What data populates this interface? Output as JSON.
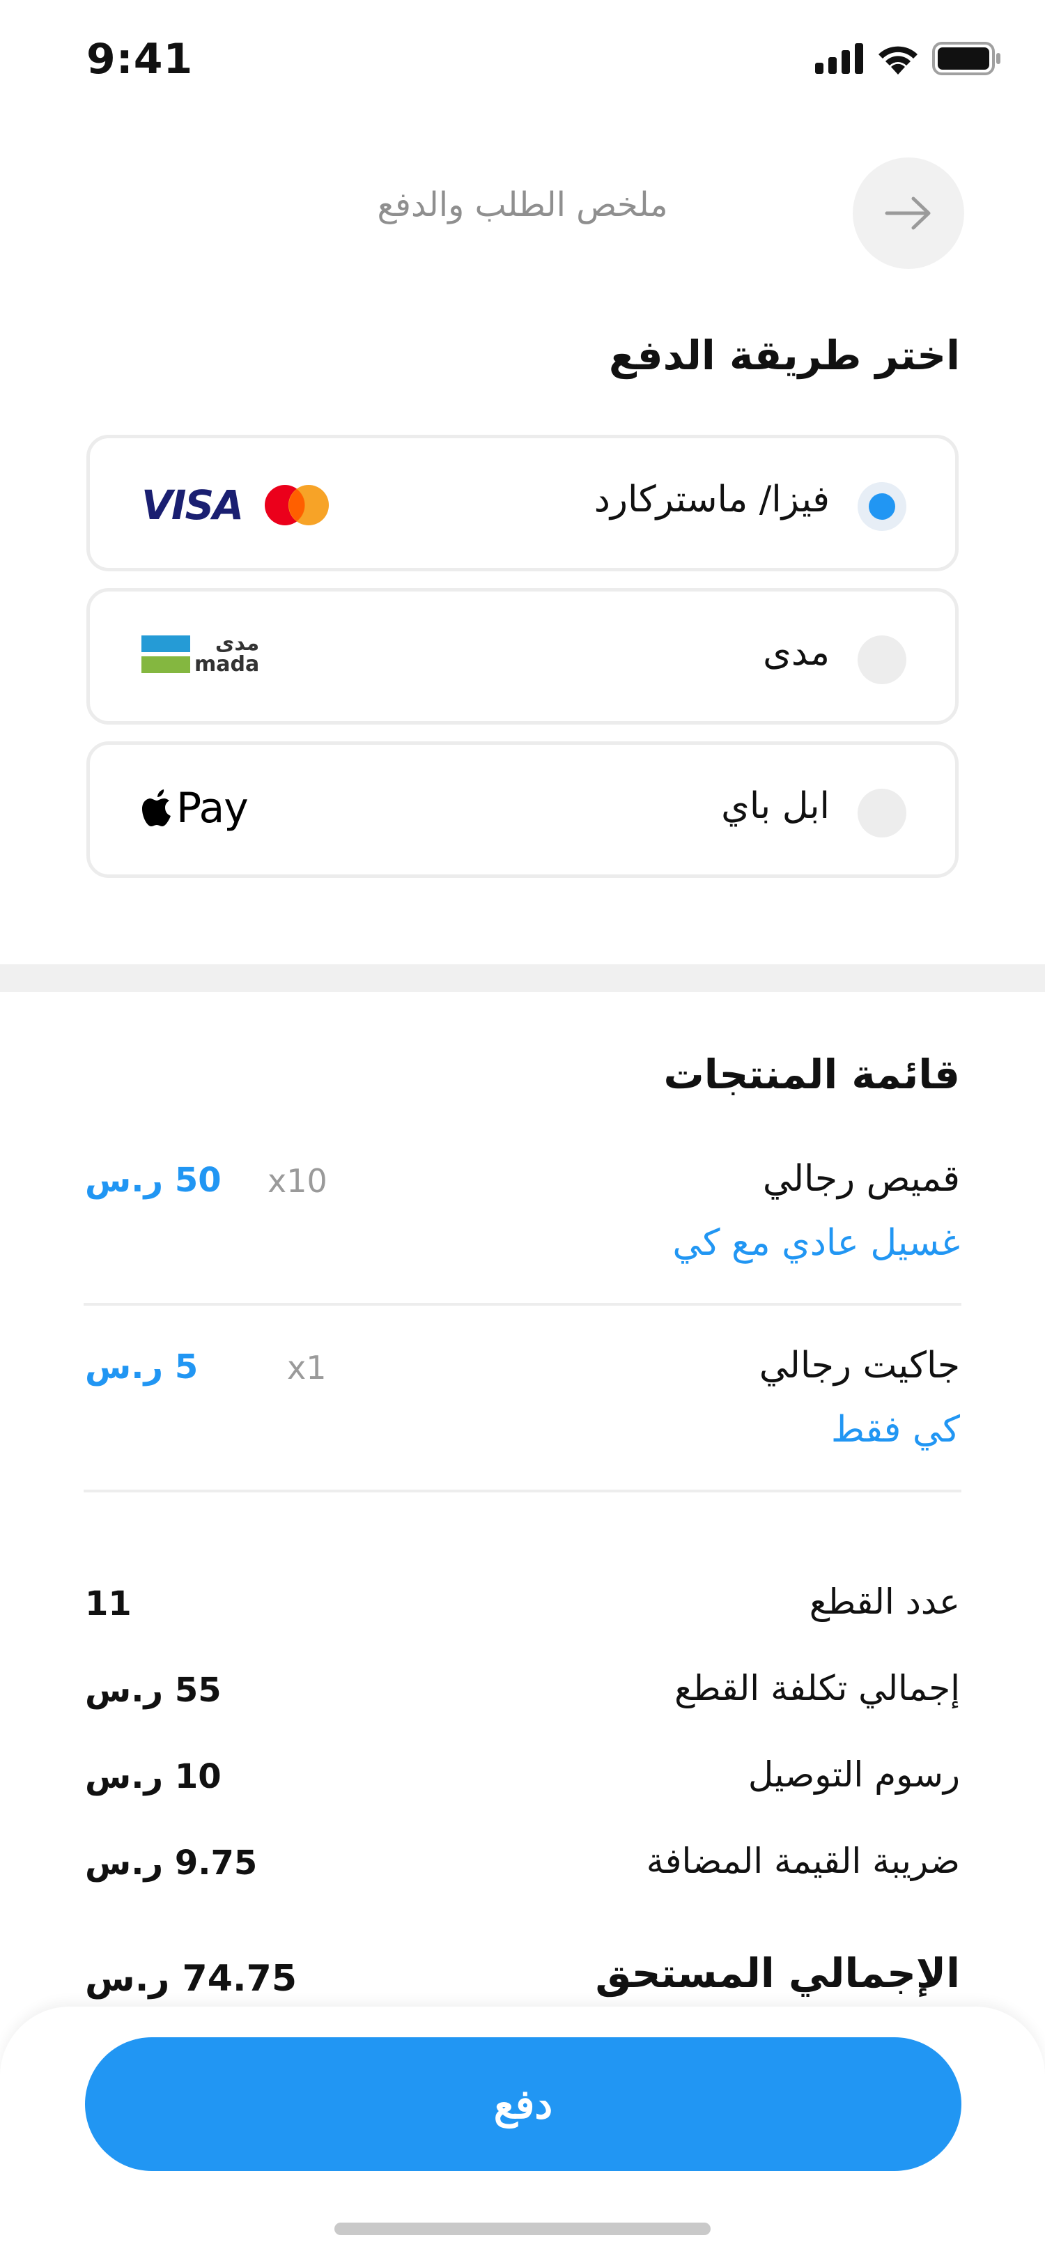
{
  "status_bar": {
    "time": "9:41"
  },
  "header": {
    "title": "ملخص الطلب والدفع"
  },
  "payment": {
    "section_title": "اختر طريقة الدفع",
    "methods": [
      {
        "label": "فيزا/ ماستركارد",
        "selected": true,
        "logo_visa": "VISA"
      },
      {
        "label": "مدى",
        "selected": false,
        "logo_ar": "مدى",
        "logo_en": "mada"
      },
      {
        "label": "ابل باي",
        "selected": false,
        "logo_text": "Pay"
      }
    ]
  },
  "products": {
    "section_title": "قائمة المنتجات",
    "items": [
      {
        "name": "قميص رجالي",
        "service": "غسيل عادي مع كي",
        "qty": "x10",
        "price": "50 ر.س"
      },
      {
        "name": "جاكيت رجالي",
        "service": "كي فقط",
        "qty": "x1",
        "price": "5 ر.س"
      }
    ]
  },
  "summary": {
    "rows": [
      {
        "label": "عدد القطع",
        "value": "11"
      },
      {
        "label": "إجمالي تكلفة القطع",
        "value": "55 ر.س"
      },
      {
        "label": "رسوم التوصيل",
        "value": "10 ر.س"
      },
      {
        "label": "ضريبة القيمة المضافة",
        "value": "9.75 ر.س"
      }
    ],
    "total_label": "الإجمالي المستحق",
    "total_value": "74.75 ر.س"
  },
  "actions": {
    "pay_label": "دفع"
  },
  "colors": {
    "accent": "#2196f3",
    "visa_blue": "#1a1f71",
    "mc_red": "#eb001b",
    "mc_orange": "#f79e1b",
    "mada_blue": "#259bd6",
    "mada_green": "#84b740"
  }
}
